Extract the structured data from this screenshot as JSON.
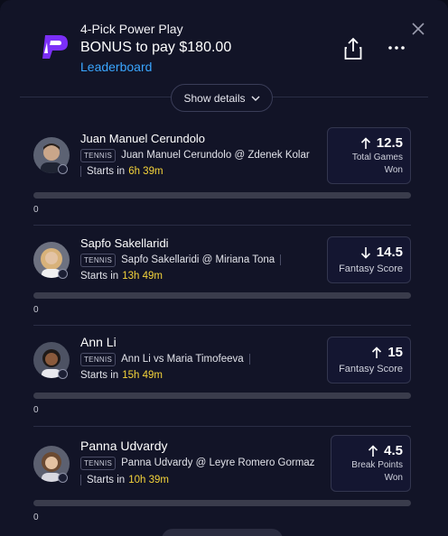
{
  "header": {
    "title": "4-Pick Power Play",
    "subtitle": "BONUS to pay $180.00",
    "leaderboard_link": "Leaderboard",
    "show_details": "Show details"
  },
  "picks": [
    {
      "player": "Juan Manuel Cerundolo",
      "sport": "TENNIS",
      "matchup": "Juan Manuel Cerundolo @ Zdenek Kolar",
      "starts_label": "Starts in",
      "starts_time": "6h 39m",
      "direction": "up",
      "line": "12.5",
      "stat": [
        "Total Games",
        "Won"
      ],
      "progress_value": "0",
      "progress_fraction": 0
    },
    {
      "player": "Sapfo Sakellaridi",
      "sport": "TENNIS",
      "matchup": "Sapfo Sakellaridi @ Miriana Tona",
      "starts_label": "Starts in",
      "starts_time": "13h 49m",
      "direction": "down",
      "line": "14.5",
      "stat": [
        "Fantasy Score"
      ],
      "progress_value": "0",
      "progress_fraction": 0
    },
    {
      "player": "Ann Li",
      "sport": "TENNIS",
      "matchup": "Ann Li vs Maria Timofeeva",
      "starts_label": "Starts in",
      "starts_time": "15h 49m",
      "direction": "up",
      "line": "15",
      "stat": [
        "Fantasy Score"
      ],
      "progress_value": "0",
      "progress_fraction": 0
    },
    {
      "player": "Panna Udvardy",
      "sport": "TENNIS",
      "matchup": "Panna Udvardy @ Leyre Romero Gormaz",
      "starts_label": "Starts in",
      "starts_time": "10h 39m",
      "direction": "up",
      "line": "4.5",
      "stat": [
        "Break Points",
        "Won"
      ],
      "progress_value": "0",
      "progress_fraction": 0
    }
  ],
  "colors": {
    "background": "#121427",
    "accent_link": "#3aa6ff",
    "start_time": "#f4d33a",
    "logo": "#8a2be2"
  },
  "icons": {
    "logo": "prizepicks-logo",
    "share": "share-icon",
    "more": "more-horizontal-icon",
    "close": "close-icon",
    "chevron": "chevron-down-icon",
    "arrow_up": "arrow-up-icon",
    "arrow_down": "arrow-down-icon"
  }
}
